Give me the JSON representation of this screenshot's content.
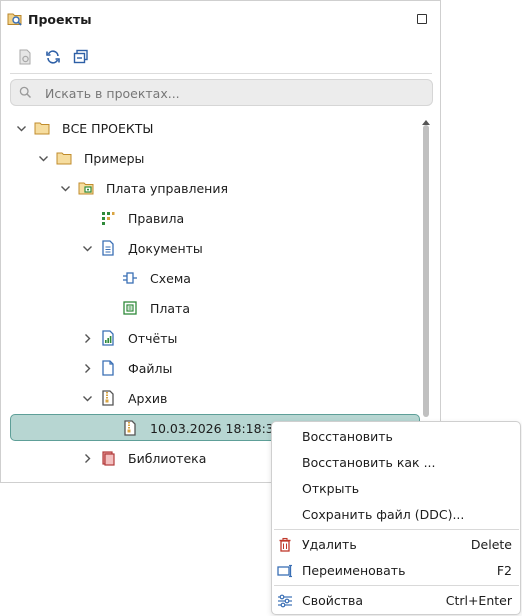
{
  "panel": {
    "title": "Проекты",
    "icons": {
      "title": "projects-icon",
      "maximize": "maximize-icon"
    }
  },
  "toolbar": {
    "buttons": [
      {
        "name": "open-project-icon",
        "enabled": false
      },
      {
        "name": "refresh-icon",
        "enabled": true
      },
      {
        "name": "collapse-all-icon",
        "enabled": true
      }
    ]
  },
  "search": {
    "placeholder": "Искать в проектах..."
  },
  "tree": {
    "items": [
      {
        "label": "ВСЕ ПРОЕКТЫ",
        "icon": "folder-icon",
        "expanded": true
      },
      {
        "label": "Примеры",
        "icon": "folder-icon",
        "expanded": true
      },
      {
        "label": "Плата управления",
        "icon": "project-folder-icon",
        "expanded": true
      },
      {
        "label": "Правила",
        "icon": "rules-icon"
      },
      {
        "label": "Документы",
        "icon": "documents-icon",
        "expanded": true
      },
      {
        "label": "Схема",
        "icon": "schematic-icon"
      },
      {
        "label": "Плата",
        "icon": "board-icon"
      },
      {
        "label": "Отчёты",
        "icon": "reports-icon",
        "expanded": false
      },
      {
        "label": "Файлы",
        "icon": "files-icon",
        "expanded": false
      },
      {
        "label": "Архив",
        "icon": "archive-icon",
        "expanded": true
      },
      {
        "label": "10.03.2026 18:18:31",
        "icon": "archive-item-icon",
        "selected": true
      },
      {
        "label": "Библиотека",
        "icon": "library-icon",
        "expanded": false
      }
    ]
  },
  "context_menu": {
    "items": [
      {
        "label": "Восстановить",
        "shortcut": ""
      },
      {
        "label": "Восстановить как ...",
        "shortcut": ""
      },
      {
        "label": "Открыть",
        "shortcut": ""
      },
      {
        "label": "Сохранить файл (DDC)...",
        "shortcut": ""
      },
      {
        "label": "Удалить",
        "shortcut": "Delete",
        "icon": "trash-icon"
      },
      {
        "label": "Переименовать",
        "shortcut": "F2",
        "icon": "rename-icon"
      },
      {
        "label": "Свойства",
        "shortcut": "Ctrl+Enter",
        "icon": "properties-icon"
      }
    ]
  },
  "colors": {
    "selection_bg": "#b7d6d2",
    "selection_border": "#5e9f98",
    "folder": "#d9a441",
    "doc_blue": "#3a6fb5",
    "green": "#2f8a3a",
    "danger": "#c0392b"
  }
}
